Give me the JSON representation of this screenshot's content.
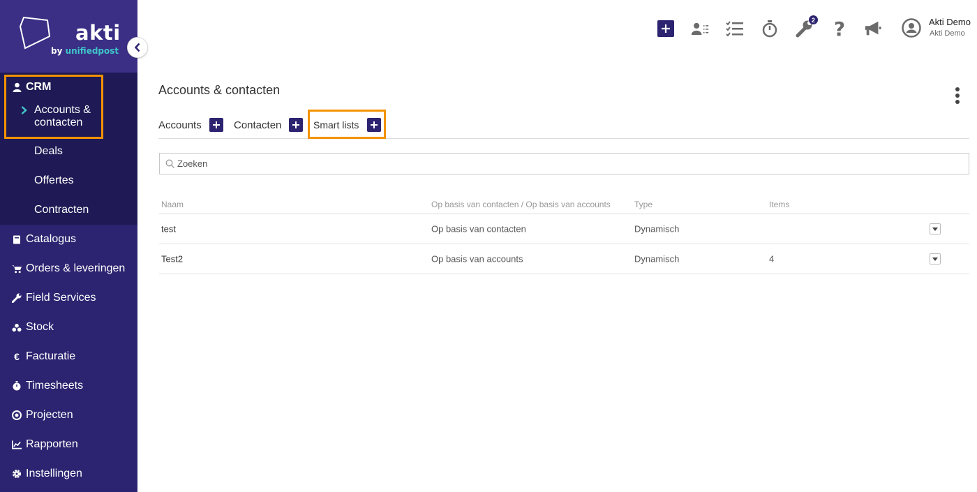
{
  "brand": {
    "name": "akti",
    "sub_prefix": "by ",
    "sub_name": "unifiedpost"
  },
  "sidebar": {
    "crm_label": "CRM",
    "crm_items": [
      {
        "label": "Accounts &",
        "label2": "contacten",
        "active": true
      },
      {
        "label": "Deals"
      },
      {
        "label": "Offertes"
      },
      {
        "label": "Contracten"
      }
    ],
    "items": [
      {
        "label": "Catalogus",
        "icon": "book-icon"
      },
      {
        "label": "Orders & leveringen",
        "icon": "cart-icon"
      },
      {
        "label": "Field Services",
        "icon": "wrench-icon"
      },
      {
        "label": "Stock",
        "icon": "boxes-icon"
      },
      {
        "label": "Facturatie",
        "icon": "euro-icon"
      },
      {
        "label": "Timesheets",
        "icon": "stopwatch-icon"
      },
      {
        "label": "Projecten",
        "icon": "target-icon"
      },
      {
        "label": "Rapporten",
        "icon": "chart-icon"
      },
      {
        "label": "Instellingen",
        "icon": "gear-icon"
      }
    ]
  },
  "topbar": {
    "notification_count": "2",
    "user_name": "Akti Demo",
    "user_company": "Akti Demo"
  },
  "page": {
    "title": "Accounts & contacten",
    "tabs": [
      {
        "label": "Accounts"
      },
      {
        "label": "Contacten"
      },
      {
        "label": "Smart lists",
        "active": true
      }
    ],
    "search_placeholder": "Zoeken",
    "table": {
      "headers": [
        "Naam",
        "Op basis van contacten / Op basis van accounts",
        "Type",
        "Items"
      ],
      "rows": [
        {
          "naam": "test",
          "basis": "Op basis van contacten",
          "type": "Dynamisch",
          "items": ""
        },
        {
          "naam": "Test2",
          "basis": "Op basis van accounts",
          "type": "Dynamisch",
          "items": "4"
        }
      ]
    }
  },
  "colors": {
    "sidebar": "#2c2470",
    "sidebar_active": "#1f1a55",
    "accent": "#3fc6c9",
    "highlight": "#f39200"
  }
}
